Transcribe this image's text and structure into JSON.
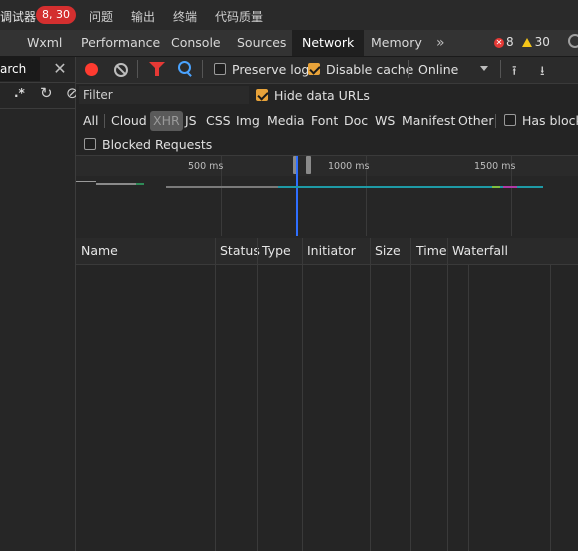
{
  "topbar": {
    "title": "调试器",
    "error_pill": "8, 30",
    "tabs": [
      "问题",
      "输出",
      "终端",
      "代码质量"
    ]
  },
  "devtools_tabs": {
    "items": [
      "Wxml",
      "Performance",
      "Console",
      "Sources",
      "Network",
      "Memory"
    ],
    "active": "Network",
    "more": "»",
    "errors": "8",
    "warnings": "30"
  },
  "left_panel": {
    "search_tab": "arch",
    "close": "✕",
    "regex": ".*",
    "refresh": "↻",
    "clear": "⊘"
  },
  "toolbar": {
    "preserve_log": "Preserve log",
    "preserve_log_checked": false,
    "disable_cache": "Disable cache",
    "disable_cache_checked": true,
    "throttling": "Online",
    "import": "⭱",
    "export": "⭳"
  },
  "filter": {
    "placeholder": "Filter",
    "hide_data_urls": "Hide data URLs",
    "hide_data_urls_checked": true,
    "types": [
      "All",
      "Cloud",
      "XHR",
      "JS",
      "CSS",
      "Img",
      "Media",
      "Font",
      "Doc",
      "WS",
      "Manifest",
      "Other"
    ],
    "active_type": "XHR",
    "has_blocked": "Has blocke",
    "blocked_requests": "Blocked Requests"
  },
  "overview": {
    "ticks": [
      "500 ms",
      "1000 ms",
      "1500 ms"
    ]
  },
  "table": {
    "columns": [
      "Name",
      "Status",
      "Type",
      "Initiator",
      "Size",
      "Time",
      "Waterfall"
    ]
  },
  "colors": {
    "accent_checkbox": "#e8a33a",
    "record": "#ff3b30",
    "error": "#e53935",
    "warning": "#f5c518",
    "search_blue": "#4aa3ff"
  }
}
